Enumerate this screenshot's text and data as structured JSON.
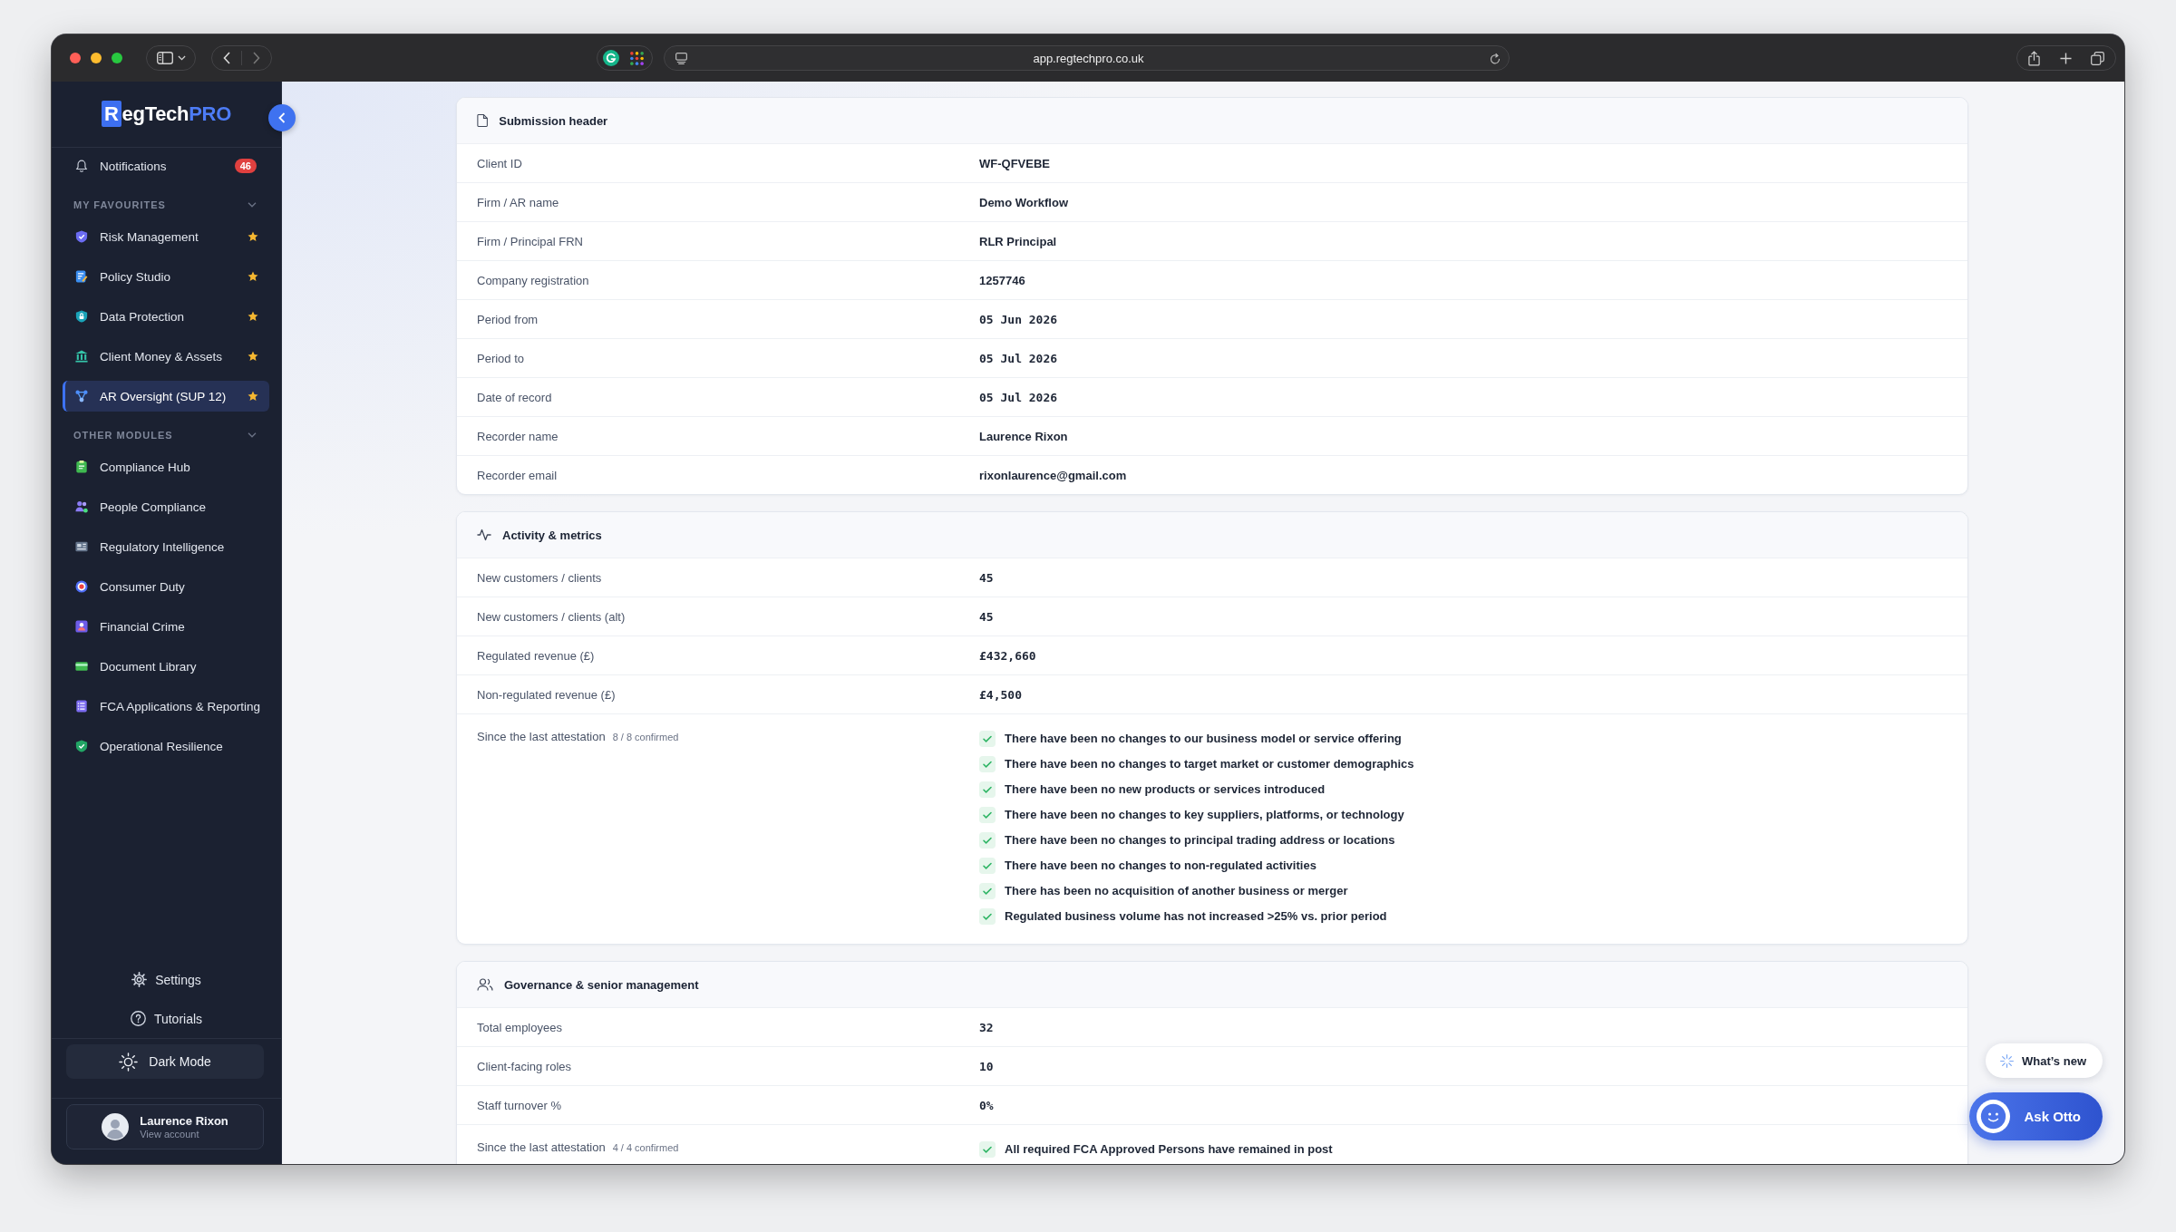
{
  "browser": {
    "url": "app.regtechpro.co.uk"
  },
  "sidebar": {
    "logo": {
      "initial": "R",
      "name": "egTech",
      "accent": "PRO"
    },
    "notifications": {
      "label": "Notifications",
      "count": "46"
    },
    "groups": [
      {
        "title": "MY FAVOURITES",
        "expanded": true,
        "items": [
          {
            "label": "Risk Management",
            "favourite": true,
            "selected": false
          },
          {
            "label": "Policy Studio",
            "favourite": true,
            "selected": false
          },
          {
            "label": "Data Protection",
            "favourite": true,
            "selected": false
          },
          {
            "label": "Client Money & Assets",
            "favourite": true,
            "selected": false
          },
          {
            "label": "AR Oversight (SUP 12)",
            "favourite": true,
            "selected": true
          }
        ]
      },
      {
        "title": "OTHER MODULES",
        "expanded": true,
        "items": [
          {
            "label": "Compliance Hub",
            "favourite": false,
            "selected": false
          },
          {
            "label": "People Compliance",
            "favourite": false,
            "selected": false
          },
          {
            "label": "Regulatory Intelligence",
            "favourite": false,
            "selected": false
          },
          {
            "label": "Consumer Duty",
            "favourite": false,
            "selected": false
          },
          {
            "label": "Financial Crime",
            "favourite": false,
            "selected": false
          },
          {
            "label": "Document Library",
            "favourite": false,
            "selected": false
          },
          {
            "label": "FCA Applications & Reporting",
            "favourite": false,
            "selected": false
          },
          {
            "label": "Operational Resilience",
            "favourite": false,
            "selected": false
          }
        ]
      }
    ],
    "settings": "Settings",
    "tutorials": "Tutorials",
    "dark_mode": "Dark Mode",
    "account": {
      "name": "Laurence Rixon",
      "link": "View account"
    }
  },
  "sections": [
    {
      "title": "Submission header",
      "rows": [
        {
          "kind": "text",
          "label": "Client ID",
          "value": "WF-QFVEBE"
        },
        {
          "kind": "text",
          "label": "Firm / AR name",
          "value": "Demo Workflow"
        },
        {
          "kind": "text",
          "label": "Firm / Principal FRN",
          "value": "RLR Principal"
        },
        {
          "kind": "text",
          "label": "Company registration",
          "value": "1257746"
        },
        {
          "kind": "mono",
          "label": "Period from",
          "value": "05 Jun 2026"
        },
        {
          "kind": "mono",
          "label": "Period to",
          "value": "05 Jul 2026"
        },
        {
          "kind": "mono",
          "label": "Date of record",
          "value": "05 Jul 2026"
        },
        {
          "kind": "text",
          "label": "Recorder name",
          "value": "Laurence Rixon"
        },
        {
          "kind": "text",
          "label": "Recorder email",
          "value": "rixonlaurence@gmail.com"
        }
      ]
    },
    {
      "title": "Activity & metrics",
      "rows": [
        {
          "kind": "mono",
          "label": "New customers / clients",
          "value": "45"
        },
        {
          "kind": "mono",
          "label": "New customers / clients (alt)",
          "value": "45"
        },
        {
          "kind": "mono",
          "label": "Regulated revenue (£)",
          "value": "£432,660"
        },
        {
          "kind": "mono",
          "label": "Non-regulated revenue (£)",
          "value": "£4,500"
        },
        {
          "kind": "checklist",
          "label": "Since the last attestation",
          "count": "8 / 8 confirmed",
          "items": [
            {
              "text": "There have been no changes to our business model or service offering",
              "checked": true
            },
            {
              "text": "There have been no changes to target market or customer demographics",
              "checked": true
            },
            {
              "text": "There have been no new products or services introduced",
              "checked": true
            },
            {
              "text": "There have been no changes to key suppliers, platforms, or technology",
              "checked": true
            },
            {
              "text": "There have been no changes to principal trading address or locations",
              "checked": true
            },
            {
              "text": "There have been no changes to non-regulated activities",
              "checked": true
            },
            {
              "text": "There has been no acquisition of another business or merger",
              "checked": true
            },
            {
              "text": "Regulated business volume has not increased >25% vs. prior period",
              "checked": true
            }
          ]
        }
      ]
    },
    {
      "title": "Governance & senior management",
      "rows": [
        {
          "kind": "mono",
          "label": "Total employees",
          "value": "32"
        },
        {
          "kind": "mono",
          "label": "Client-facing roles",
          "value": "10"
        },
        {
          "kind": "mono",
          "label": "Staff turnover %",
          "value": "0%"
        },
        {
          "kind": "checklist",
          "label": "Since the last attestation",
          "count": "4 / 4 confirmed",
          "items": [
            {
              "text": "All required FCA Approved Persons have remained in post",
              "checked": true
            }
          ]
        }
      ]
    }
  ],
  "whats_new": "What’s new",
  "assistant": "Ask Otto"
}
